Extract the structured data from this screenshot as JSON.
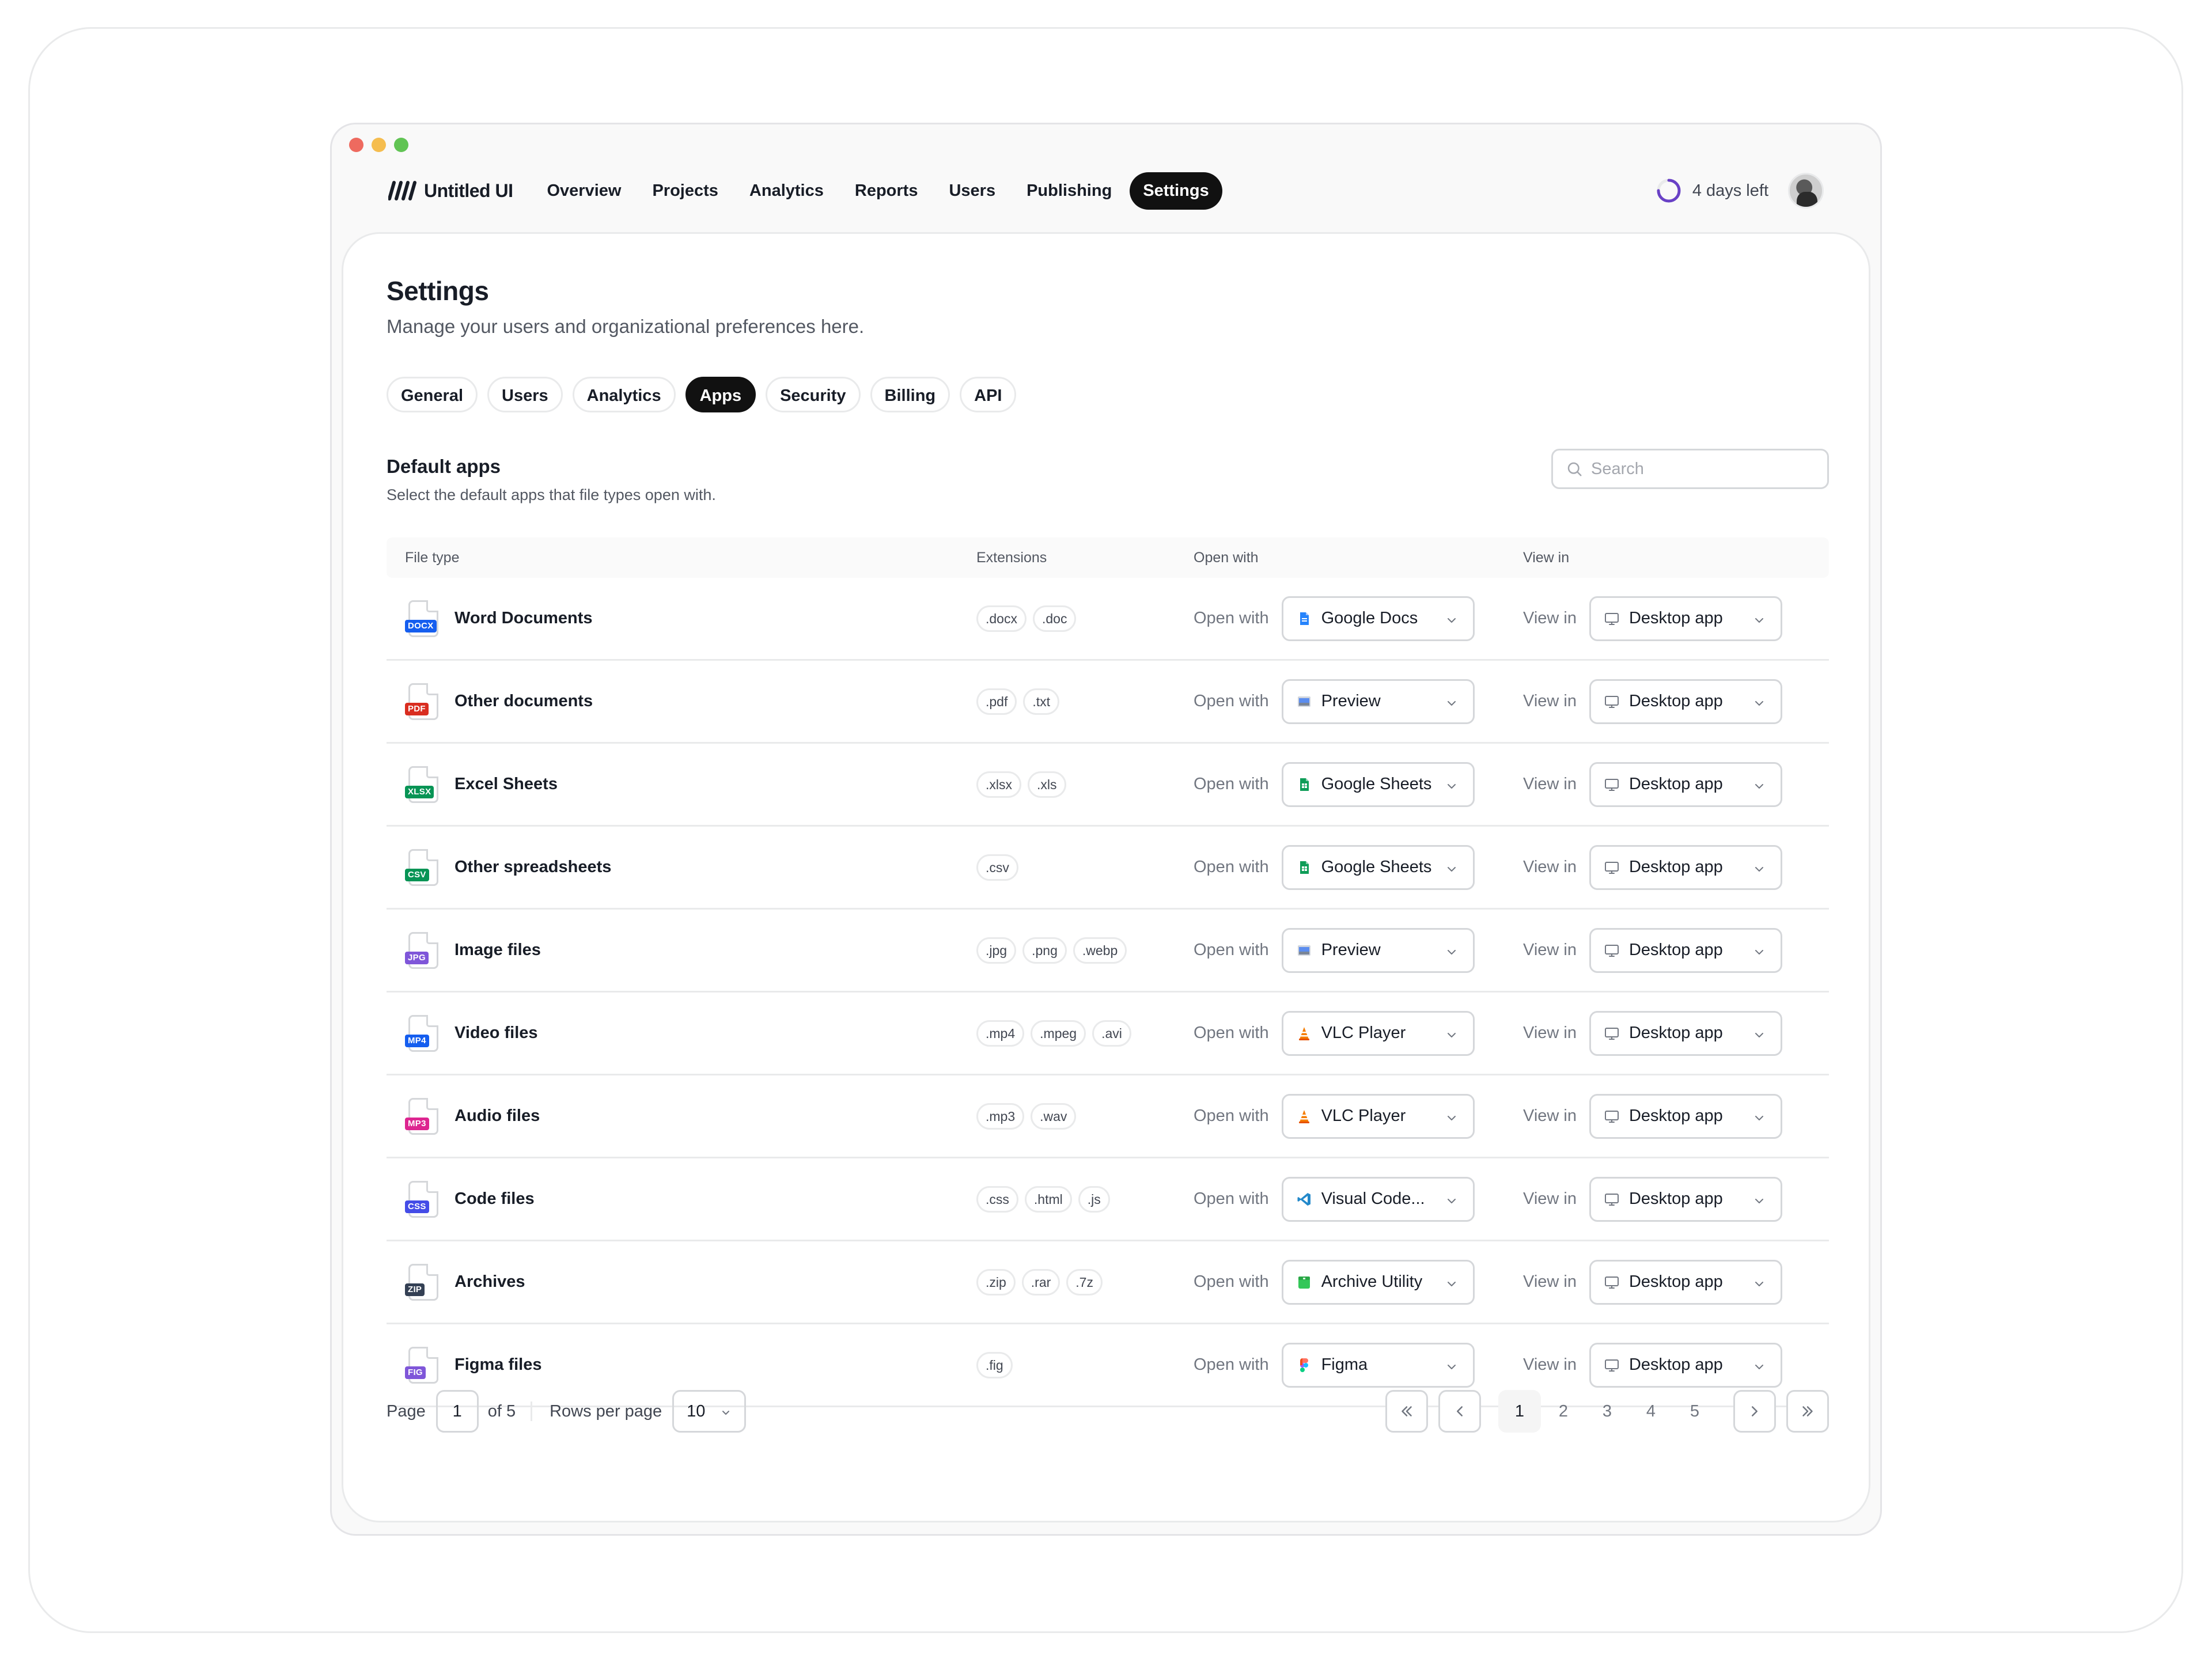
{
  "app": {
    "brand": "Untitled UI"
  },
  "nav": {
    "items": [
      "Overview",
      "Projects",
      "Analytics",
      "Reports",
      "Users",
      "Publishing",
      "Settings"
    ],
    "active_index": 6,
    "trial_text": "4 days left",
    "trial_progress": 0.75
  },
  "page": {
    "title": "Settings",
    "subtitle": "Manage your users and organizational preferences here."
  },
  "tabs": {
    "items": [
      "General",
      "Users",
      "Analytics",
      "Apps",
      "Security",
      "Billing",
      "API"
    ],
    "active_index": 3
  },
  "section": {
    "title": "Default apps",
    "subtitle": "Select the default apps that file types open with."
  },
  "search": {
    "placeholder": "Search",
    "value": ""
  },
  "table": {
    "headers": [
      "File type",
      "Extensions",
      "Open with",
      "View in"
    ],
    "open_with_label": "Open with",
    "view_in_label": "View in",
    "rows": [
      {
        "name": "Word Documents",
        "badge": "DOCX",
        "badge_color": "#155eef",
        "extensions": [
          ".docx",
          ".doc"
        ],
        "app": "Google Docs",
        "app_icon": "google-docs-icon",
        "view": "Desktop app"
      },
      {
        "name": "Other documents",
        "badge": "PDF",
        "badge_color": "#d92d20",
        "extensions": [
          ".pdf",
          ".txt"
        ],
        "app": "Preview",
        "app_icon": "preview-icon",
        "view": "Desktop app"
      },
      {
        "name": "Excel Sheets",
        "badge": "XLSX",
        "badge_color": "#079455",
        "extensions": [
          ".xlsx",
          ".xls"
        ],
        "app": "Google Sheets",
        "app_icon": "google-sheets-icon",
        "view": "Desktop app"
      },
      {
        "name": "Other spreadsheets",
        "badge": "CSV",
        "badge_color": "#079455",
        "extensions": [
          ".csv"
        ],
        "app": "Google Sheets",
        "app_icon": "google-sheets-icon",
        "view": "Desktop app"
      },
      {
        "name": "Image files",
        "badge": "JPG",
        "badge_color": "#7f56d9",
        "extensions": [
          ".jpg",
          ".png",
          ".webp"
        ],
        "app": "Preview",
        "app_icon": "preview-icon",
        "view": "Desktop app"
      },
      {
        "name": "Video files",
        "badge": "MP4",
        "badge_color": "#155eef",
        "extensions": [
          ".mp4",
          ".mpeg",
          ".avi"
        ],
        "app": "VLC Player",
        "app_icon": "vlc-icon",
        "view": "Desktop app"
      },
      {
        "name": "Audio files",
        "badge": "MP3",
        "badge_color": "#dd2590",
        "extensions": [
          ".mp3",
          ".wav"
        ],
        "app": "VLC Player",
        "app_icon": "vlc-icon",
        "view": "Desktop app"
      },
      {
        "name": "Code files",
        "badge": "CSS",
        "badge_color": "#444ce7",
        "extensions": [
          ".css",
          ".html",
          ".js"
        ],
        "app": "Visual Code...",
        "app_icon": "vscode-icon",
        "view": "Desktop app"
      },
      {
        "name": "Archives",
        "badge": "ZIP",
        "badge_color": "#344054",
        "extensions": [
          ".zip",
          ".rar",
          ".7z"
        ],
        "app": "Archive Utility",
        "app_icon": "archive-utility-icon",
        "view": "Desktop app"
      },
      {
        "name": "Figma files",
        "badge": "FIG",
        "badge_color": "#7f56d9",
        "extensions": [
          ".fig"
        ],
        "app": "Figma",
        "app_icon": "figma-icon",
        "view": "Desktop app"
      }
    ]
  },
  "pagination": {
    "page_label": "Page",
    "current_page": "1",
    "of_label": "of 5",
    "rows_label": "Rows per page",
    "rows_value": "10",
    "pages": [
      "1",
      "2",
      "3",
      "4",
      "5"
    ],
    "active_page_index": 0
  },
  "colors": {
    "accent": "#111111",
    "trial_ring": "#6941c6"
  }
}
